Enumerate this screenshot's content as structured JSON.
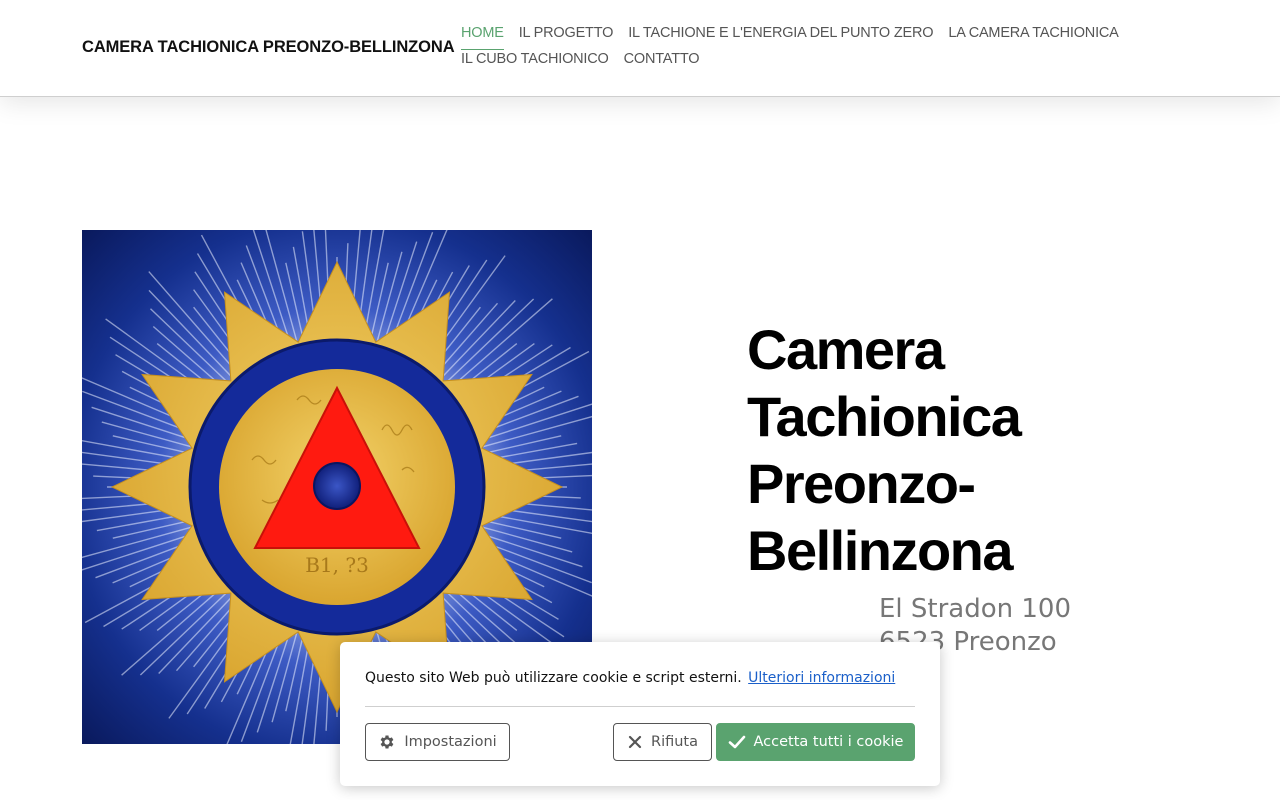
{
  "site": {
    "title": "CAMERA TACHIONICA PREONZO-BELLINZONA"
  },
  "nav": {
    "row1": [
      {
        "label": "HOME",
        "active": true
      },
      {
        "label": "IL PROGETTO"
      },
      {
        "label": "IL TACHIONE E L'ENERGIA DEL PUNTO ZERO"
      },
      {
        "label": "LA CAMERA TACHIONICA"
      }
    ],
    "row2": [
      {
        "label": "IL CUBO TACHIONICO"
      },
      {
        "label": "CONTATTO"
      }
    ]
  },
  "hero": {
    "title_lines": [
      "Camera",
      "Tachionica",
      "Preonzo-",
      "Bellinzona"
    ],
    "address_lines": [
      "El Stradon 100",
      "6523 Preonzo"
    ]
  },
  "artwork": {
    "inscription": "B1, ?3"
  },
  "cookie": {
    "text": "Questo sito Web può utilizzare cookie e script esterni.",
    "link": "Ulteriori informazioni",
    "settings": "Impostazioni",
    "reject": "Rifiuta",
    "accept": "Accetta tutti i cookie"
  },
  "colors": {
    "accent": "#5aa36f",
    "link": "#1a5fc9",
    "art_blue": "#0d1f6b",
    "art_gold": "#e8b931",
    "art_red": "#ff1a10"
  },
  "icons": {
    "settings": "gear-icon",
    "reject": "close-icon",
    "accept": "check-icon"
  }
}
